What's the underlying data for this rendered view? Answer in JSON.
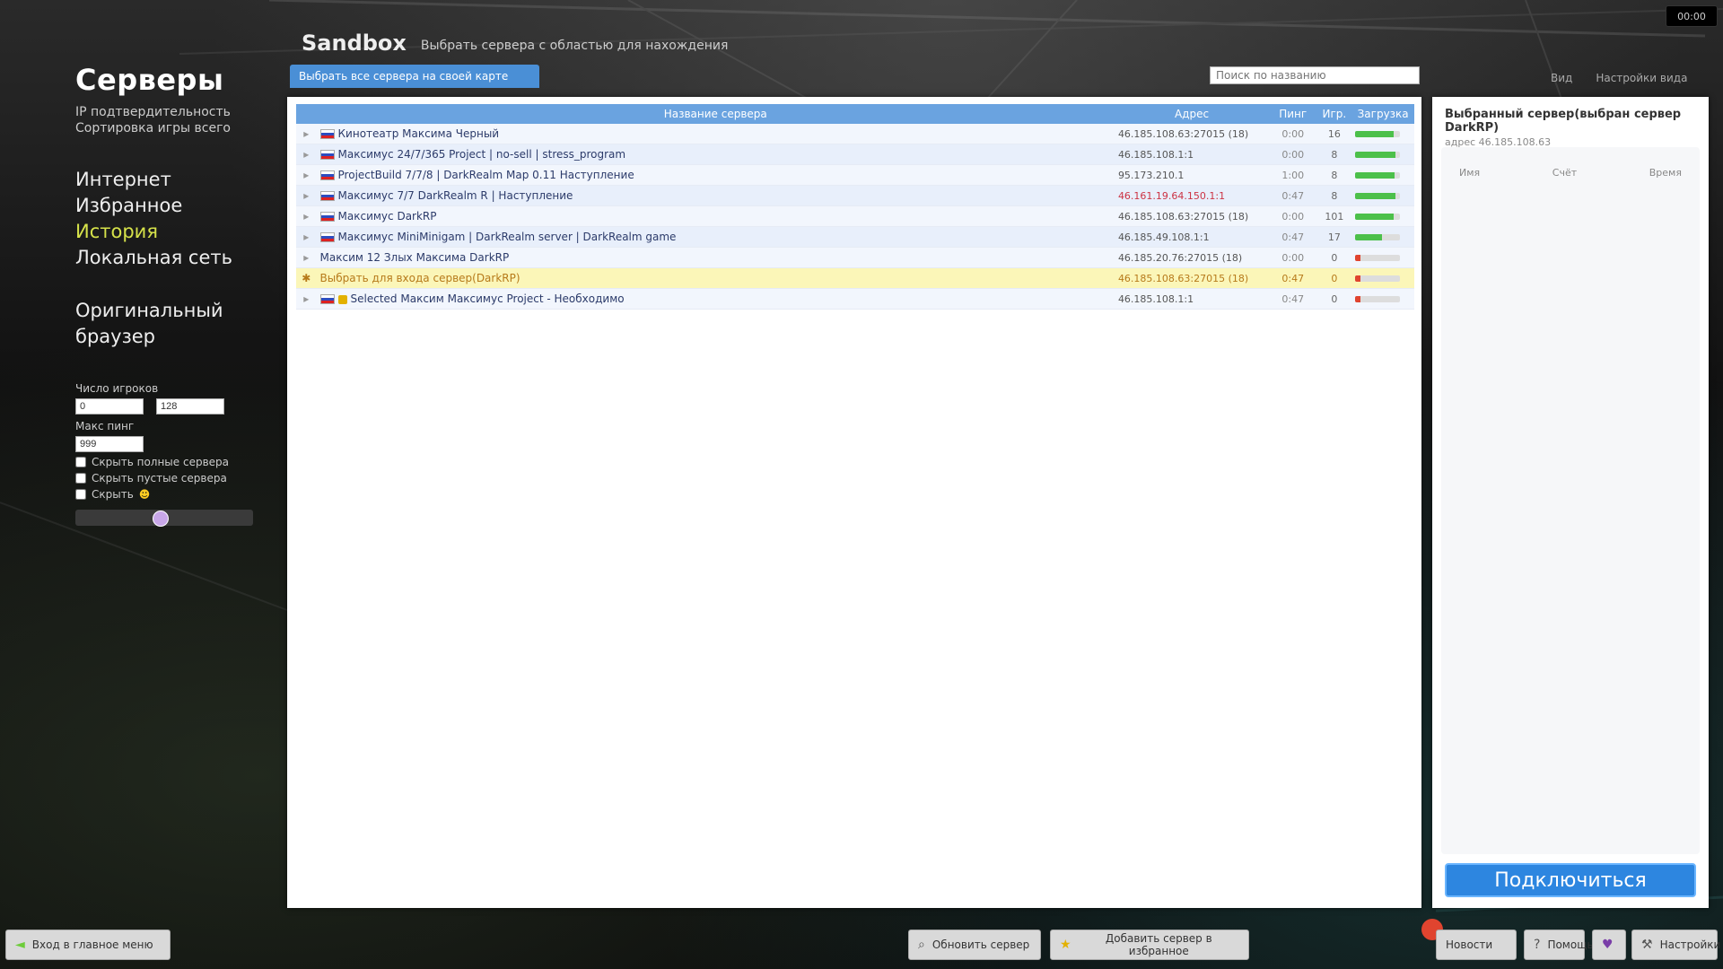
{
  "clock": "00:00",
  "sidebar": {
    "title": "Серверы",
    "subtitle_line1": "IP подтвердительность",
    "subtitle_line2": "Сортировка игры всего",
    "items": [
      {
        "label": "Интернет",
        "active": false
      },
      {
        "label": "Избранное",
        "active": false
      },
      {
        "label": "История",
        "active": true
      },
      {
        "label": "Локальная сеть",
        "active": false
      }
    ],
    "original_line1": "Оригинальный",
    "original_line2": "браузер",
    "filters": {
      "players_label": "Число игроков",
      "players_min": "0",
      "players_max": "128",
      "ping_label": "Макс пинг",
      "ping_value": "999",
      "checkbox1": "Скрыть полные сервера",
      "checkbox2": "Скрыть пустые сервера",
      "checkbox3": "Скрыть"
    }
  },
  "header": {
    "name": "Sandbox",
    "desc": "Выбрать сервера с областью для нахождения"
  },
  "tab_active": "Выбрать все сервера на своей карте",
  "search_placeholder": "Поиск по названию",
  "top_links": [
    "Вид",
    "Настройки вида"
  ],
  "table": {
    "headers": [
      "",
      "Название сервера",
      "Адрес",
      "Пинг",
      "Игр.",
      "Загрузка"
    ],
    "rows": [
      {
        "name": "Кинотеатр Максима Черный",
        "ip": "46.185.108.63:27015 (18)",
        "ping": "0:00",
        "players": "16",
        "load": 0.85,
        "style": "even",
        "icon": "flag",
        "ip_red": false
      },
      {
        "name": "Максимус 24/7/365 Project | no-sell | stress_program",
        "ip": "46.185.108.1:1",
        "ping": "0:00",
        "players": "8",
        "load": 0.9,
        "style": "odd",
        "icon": "flag",
        "ip_red": false
      },
      {
        "name": "ProjectBuild 7/7/8 | DarkRealm Map 0.11 Наступление",
        "ip": "95.173.210.1",
        "ping": "1:00",
        "players": "8",
        "load": 0.88,
        "style": "even",
        "icon": "flag",
        "ip_red": false
      },
      {
        "name": "Максимус 7/7 DarkRealm R | Наступление",
        "ip": "46.161.19.64.150.1:1",
        "ping": "0:47",
        "players": "8",
        "load": 0.9,
        "style": "odd",
        "icon": "flag",
        "ip_red": true
      },
      {
        "name": "Максимус DarkRP",
        "ip": "46.185.108.63:27015 (18)",
        "ping": "0:00",
        "players": "101",
        "load": 0.85,
        "style": "even",
        "icon": "flag",
        "ip_red": false
      },
      {
        "name": "Максимус MiniMinigam | DarkRealm server | DarkRealm game",
        "ip": "46.185.49.108.1:1",
        "ping": "0:47",
        "players": "17",
        "load": 0.6,
        "style": "odd",
        "icon": "flag",
        "ip_red": false
      },
      {
        "name": "Максим 12 Злых Максима DarkRP",
        "ip": "46.185.20.76:27015 (18)",
        "ping": "0:00",
        "players": "0",
        "load": 0.12,
        "style": "even",
        "icon": "none",
        "ip_red": false
      },
      {
        "name": "Выбрать для входа сервер(DarkRP)",
        "ip": "46.185.108.63:27015 (18)",
        "ping": "0:47",
        "players": "0",
        "load": 0.12,
        "style": "highlight",
        "icon": "star",
        "ip_red": false
      },
      {
        "name": "Selected Максим Максимус Project - Необходимо",
        "ip": "46.185.108.1:1",
        "ping": "0:47",
        "players": "0",
        "load": 0.12,
        "style": "even",
        "icon": "lock",
        "ip_red": false
      }
    ]
  },
  "info": {
    "title": "Выбранный сервер(выбран сервер DarkRP)",
    "subtitle": "адрес 46.185.108.63",
    "col1": "Имя",
    "col2": "Счёт",
    "col3": "Время",
    "connect_label": "Подключиться"
  },
  "toolbar": {
    "left_button": "Вход в главное меню",
    "refresh_button": "Обновить сервер",
    "favorites_button": "Добавить сервер в избранное",
    "news_button": "Новости",
    "help_button": "Помощь",
    "tools_button": "Настройки"
  },
  "colors": {
    "accent": "#4a8fd6",
    "connect": "#2d86e0",
    "active_menu": "#d6e24a",
    "highlight_row": "#fbf6b8"
  }
}
